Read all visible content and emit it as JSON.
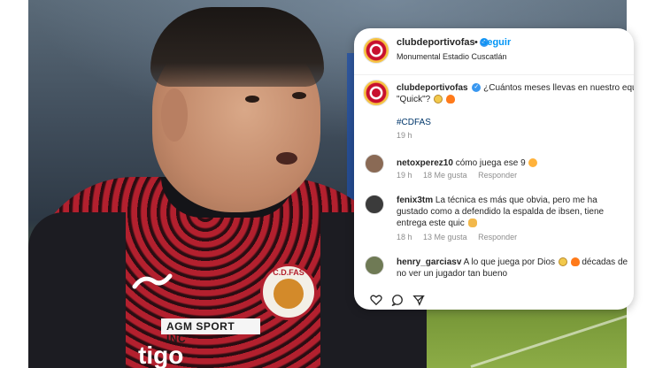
{
  "post": {
    "header": {
      "username": "clubdeportivofas",
      "separator": "•",
      "follow_label": "Seguir",
      "location": "Monumental Estadio Cuscatlán"
    },
    "caption": {
      "username": "clubdeportivofas",
      "text_line1": "¿Cuántos meses llevas en nuestro equipo",
      "text_line2": "\"Quick\"?",
      "hashtag": "#CDFAS",
      "time": "19 h"
    },
    "comments": [
      {
        "username": "netoxperez10",
        "text": "cómo juega ese 9",
        "time": "19 h",
        "likes": "18 Me gusta",
        "reply_label": "Responder"
      },
      {
        "username": "fenix3tm",
        "text": "La técnica es más que obvia, pero me ha gustado como a defendido la espalda de ibsen, tiene entrega este quic",
        "time": "18 h",
        "likes": "13 Me gusta",
        "reply_label": "Responder"
      },
      {
        "username": "henry_garciasv",
        "text": "A lo que juega por Dios",
        "text_after": "décadas de no ver un jugador tan bueno"
      }
    ]
  },
  "jersey": {
    "sponsor": "AGM SPORT INC",
    "crest_text": "C.D.FAS",
    "sponsor_2": "tigo"
  },
  "colors": {
    "link_blue": "#0095f6",
    "verified_blue": "#3897f0",
    "muted_gray": "#8e8e8e",
    "jersey_red": "#b3202e"
  },
  "icons": [
    "verified-badge-icon",
    "heart-icon",
    "comment-icon",
    "share-icon",
    "emoji-scream-icon",
    "emoji-fire-icon"
  ]
}
